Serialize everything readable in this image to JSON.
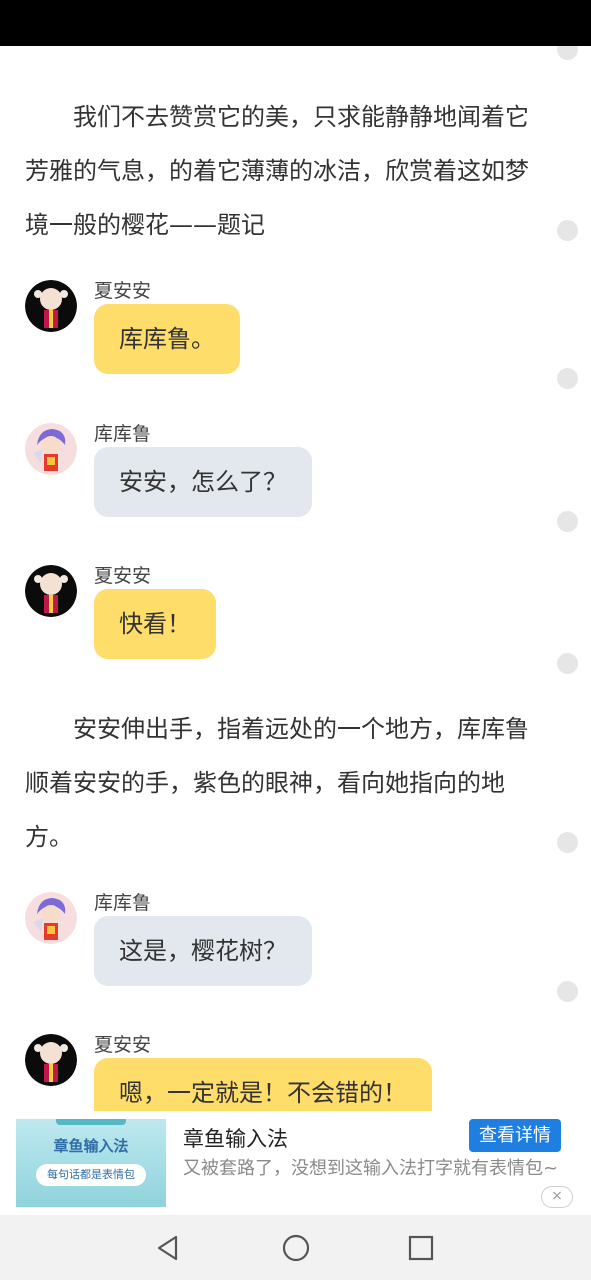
{
  "story": {
    "para1": "我们不去赞赏它的美，只求能静静地闻着它芳雅的气息，的着它薄薄的冰洁，欣赏着这如梦境一般的樱花——题记",
    "para2": "安安伸出手，指着远处的一个地方，库库鲁顺着安安的手，紫色的眼神，看向她指向的地方。"
  },
  "messages": [
    {
      "name": "夏安安",
      "text": "库库鲁。"
    },
    {
      "name": "库库鲁",
      "text": "安安，怎么了？"
    },
    {
      "name": "夏安安",
      "text": "快看！"
    },
    {
      "name": "库库鲁",
      "text": "这是，樱花树？"
    },
    {
      "name": "夏安安",
      "text": "嗯，一定就是！不会错的！"
    }
  ],
  "ad": {
    "image_title": "章鱼输入法",
    "image_tagline": "每句话都是表情包",
    "title": "章鱼输入法",
    "button": "查看详情",
    "description": "又被套路了，没想到这输入法打字就有表情包~",
    "close": "×"
  },
  "colors": {
    "bubble_self": "#fedd6b",
    "bubble_other": "#e3e8ef",
    "ad_button": "#1f7fe0"
  },
  "icons": {
    "nav_back": "triangle-back-icon",
    "nav_home": "circle-home-icon",
    "nav_recent": "square-recent-icon"
  }
}
